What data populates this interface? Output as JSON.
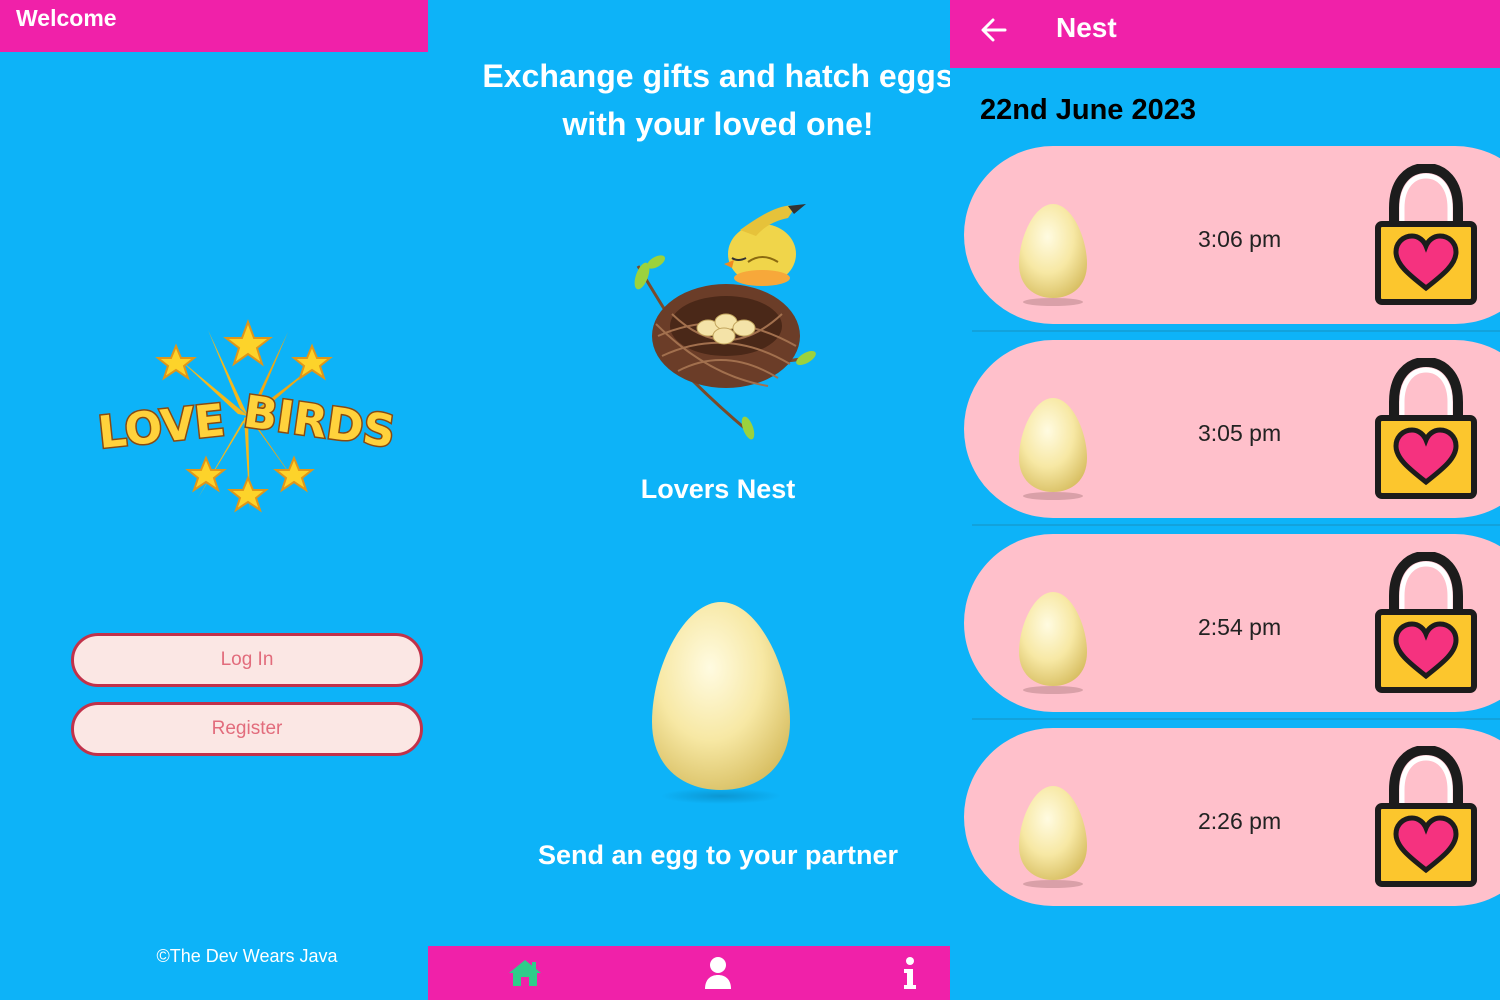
{
  "welcome_screen": {
    "title": "Welcome",
    "logo_text": "LOVE BIRDS",
    "login_label": "Log In",
    "register_label": "Register",
    "copyright": "©The Dev Wears Java"
  },
  "home_screen": {
    "headline": "Exchange gifts and hatch eggs with your loved one!",
    "nest_caption": "Lovers Nest",
    "egg_caption": "Send an egg to your partner",
    "nav": {
      "home_icon": "home-icon",
      "profile_icon": "person-icon",
      "info_icon": "info-icon",
      "active_color": "#2ecc8a"
    }
  },
  "nest_screen": {
    "title": "Nest",
    "date": "22nd June 2023",
    "eggs": [
      {
        "time": "3:06 pm",
        "status_icon": "lock-heart-icon"
      },
      {
        "time": "3:05 pm",
        "status_icon": "lock-heart-icon"
      },
      {
        "time": "2:54 pm",
        "status_icon": "lock-heart-icon"
      },
      {
        "time": "2:26 pm",
        "status_icon": "lock-heart-icon"
      }
    ]
  },
  "colors": {
    "background": "#0db3f8",
    "appbar": "#f021a9",
    "card": "#ffc0cb",
    "button_fill": "#fbe7e4",
    "button_border": "#c1324a",
    "lock_yellow": "#fcc62d",
    "heart": "#f5327f"
  }
}
